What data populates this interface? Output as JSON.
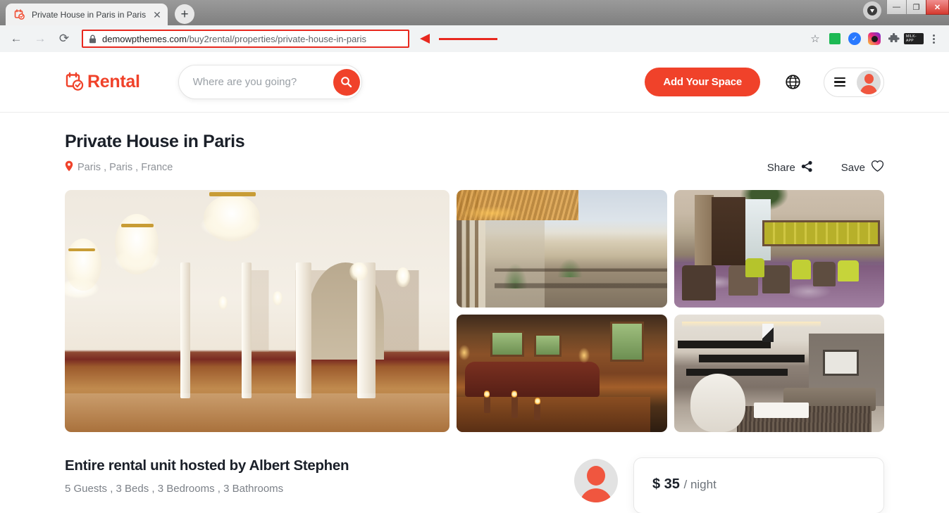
{
  "browser": {
    "tab": {
      "title": "Private House in Paris in Paris",
      "favicon_name": "rental-calendar-favicon",
      "close_label": "✕"
    },
    "new_tab_label": "+",
    "nav": {
      "back": "←",
      "forward": "→",
      "reload": "⟳"
    },
    "omnibox": {
      "lock_name": "lock-icon",
      "url_bold": "demowpthemes.com",
      "url_rest": "/buy2rental/properties/private-house-in-paris",
      "highlight_color": "#e8281e"
    },
    "toolbar_icons": [
      "bookmark-star-icon",
      "extension-green-icon",
      "extension-blue-check-icon",
      "extension-instagram-icon",
      "extensions-puzzle-icon",
      "extension-label-icon",
      "chrome-menu-kebab-icon"
    ],
    "extension_label": "MILK-APP",
    "download_badge": "download-icon",
    "window_controls": {
      "minimize": "—",
      "maximize": "❐",
      "close": "✕"
    }
  },
  "site": {
    "header": {
      "logo_text": "Rental",
      "logo_icon": "calendar-check-icon",
      "search": {
        "placeholder": "Where are you going?",
        "value": "",
        "button_icon": "search-icon"
      },
      "add_space_label": "Add Your Space",
      "globe_icon": "globe-icon",
      "menu_icon": "hamburger-icon",
      "avatar_icon": "user-avatar-icon",
      "accent_color": "#f0422a"
    },
    "listing": {
      "title": "Private House in Paris",
      "location": "Paris , Paris , France",
      "location_icon": "map-pin-icon",
      "share_label": "Share",
      "share_icon": "share-icon",
      "save_label": "Save",
      "save_icon": "heart-icon",
      "gallery": [
        {
          "name": "main-photo",
          "alt": "Grand white ballroom with crystal chandeliers"
        },
        {
          "name": "photo-2",
          "alt": "Beachfront terrace dining area"
        },
        {
          "name": "photo-3",
          "alt": "Hotel lounge with yellow chairs and purple carpet"
        },
        {
          "name": "photo-4",
          "alt": "Warm living room with candles on wooden table"
        },
        {
          "name": "photo-5",
          "alt": "Modern living room with bookshelves and art"
        }
      ],
      "host_title": "Entire rental unit hosted by Albert Stephen",
      "host_meta": "5 Guests , 3 Beds , 3 Bedrooms , 3 Bathrooms",
      "price_amount": "$ 35",
      "price_unit": "/ night"
    }
  }
}
